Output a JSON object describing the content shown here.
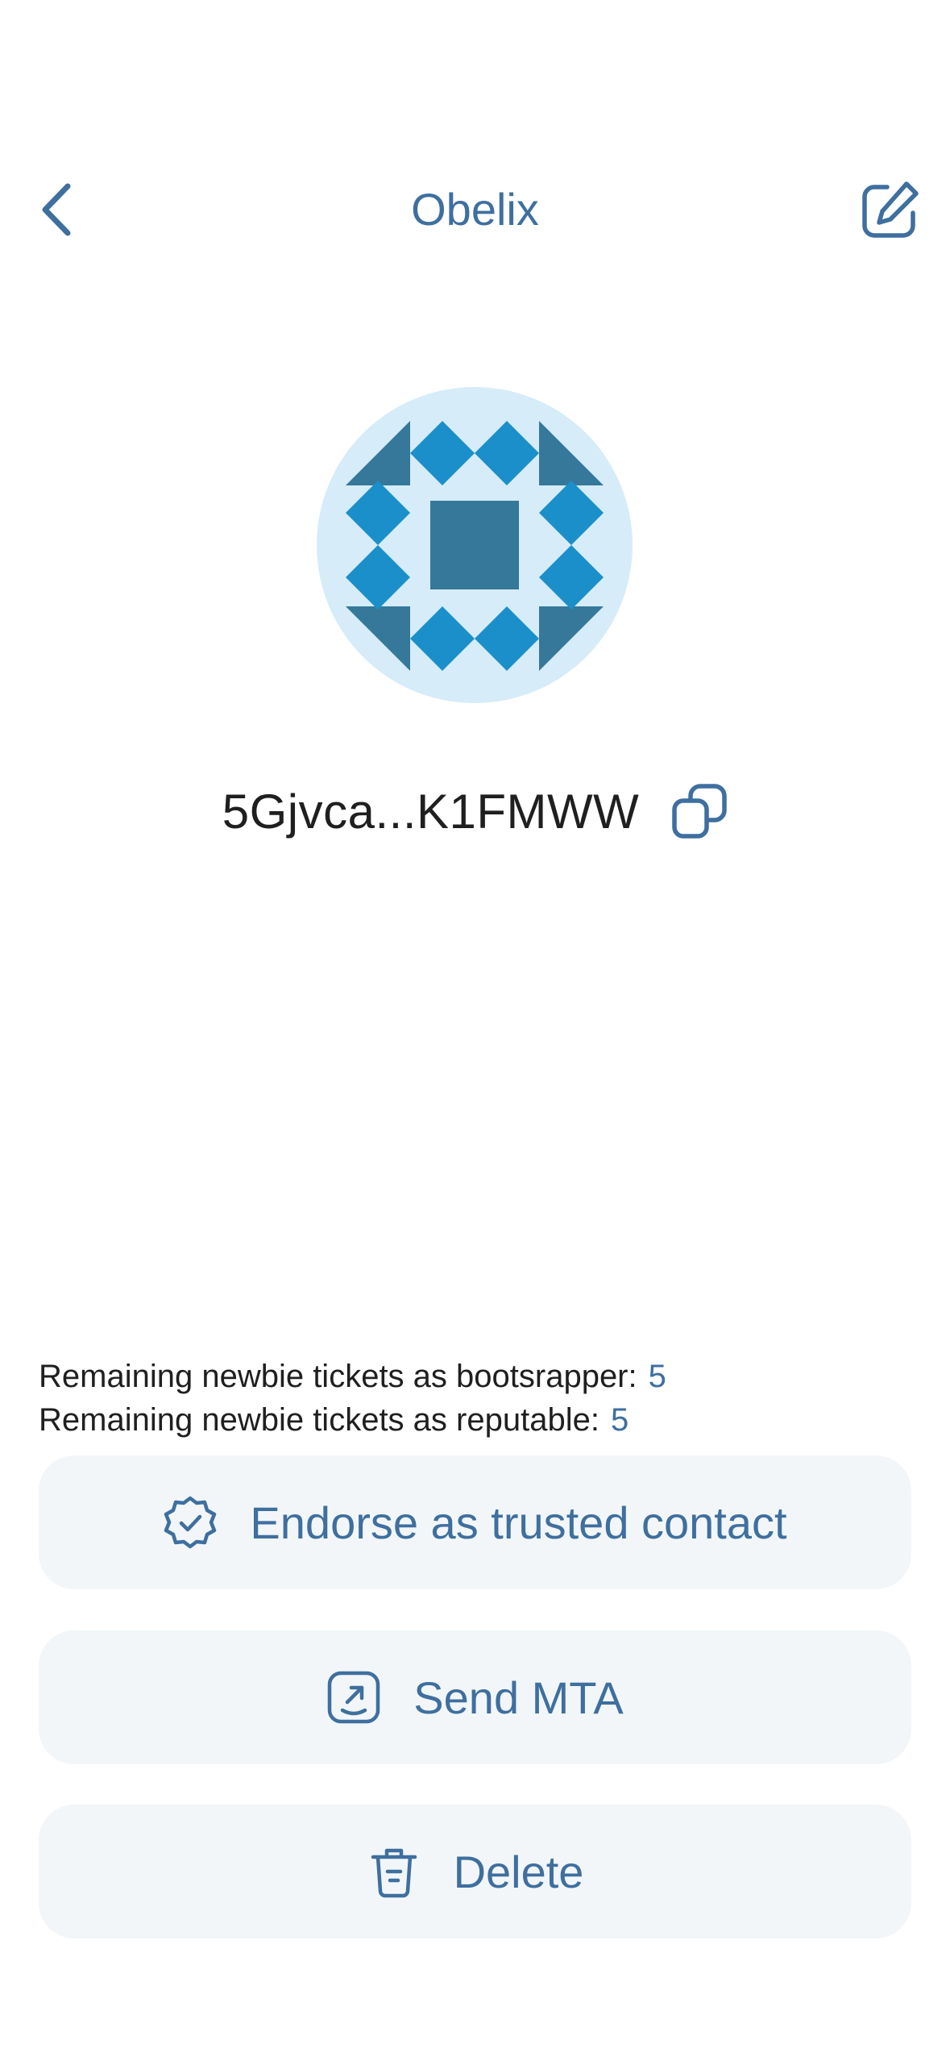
{
  "header": {
    "title": "Obelix",
    "back_icon": "chevron-left-icon",
    "edit_icon": "edit-pencil-icon"
  },
  "contact": {
    "address": "5Gjvca...K1FMWW",
    "avatar_icon": "identicon-avatar",
    "copy_icon": "copy-icon"
  },
  "tickets": {
    "bootstrapper_label": "Remaining newbie tickets as bootsrapper:",
    "bootstrapper_value": "5",
    "reputable_label": "Remaining newbie tickets as reputable:",
    "reputable_value": "5"
  },
  "actions": {
    "endorse_label": "Endorse as trusted contact",
    "endorse_icon": "verified-badge-icon",
    "send_label": "Send MTA",
    "send_icon": "send-arrow-icon",
    "delete_label": "Delete",
    "delete_icon": "trash-icon"
  },
  "colors": {
    "accent": "#3e6f9f",
    "avatar_bg": "#d6ecf8",
    "avatar_light": "#1b8fca",
    "avatar_dark": "#35789a",
    "button_bg": "#f2f6f8",
    "text": "#1f1f1f"
  }
}
